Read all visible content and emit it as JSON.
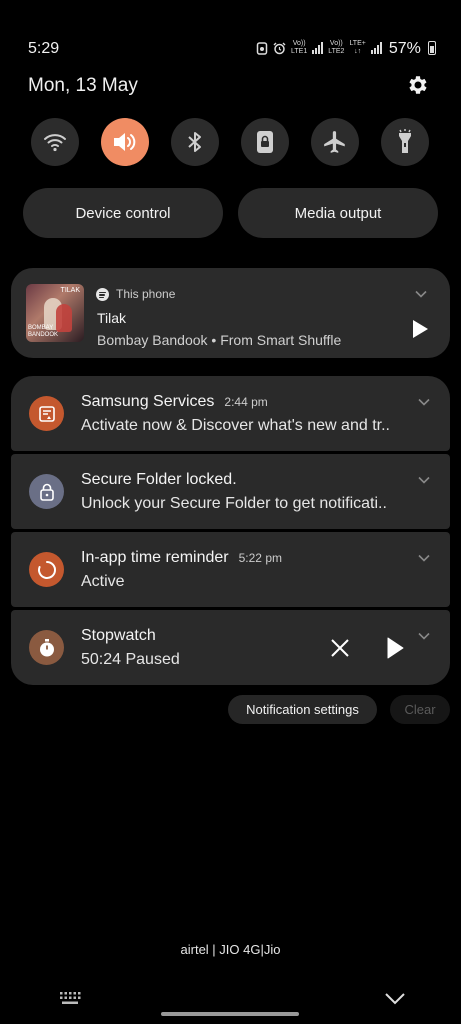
{
  "status_bar": {
    "time": "5:29",
    "sim1": {
      "top": "Vo))",
      "bottom": "LTE1"
    },
    "sim2": {
      "top": "Vo))",
      "bottom": "LTE2"
    },
    "sim2_net": {
      "top": "LTE+",
      "bottom": "↓↑"
    },
    "battery_percent": "57%",
    "battery_level": 0.57
  },
  "header": {
    "date": "Mon, 13 May"
  },
  "quick_toggles": [
    {
      "name": "wifi",
      "active": false
    },
    {
      "name": "sound",
      "active": true
    },
    {
      "name": "bluetooth",
      "active": false
    },
    {
      "name": "screen-lock-rotation",
      "active": false
    },
    {
      "name": "airplane",
      "active": false
    },
    {
      "name": "flashlight",
      "active": false
    }
  ],
  "buttons": {
    "device_control": "Device control",
    "media_output": "Media output"
  },
  "media": {
    "source": "This phone",
    "title": "Tilak",
    "artist": "Bombay Bandook • From Smart Shuffle",
    "album_title": "TILAK",
    "album_subtitle": "BOMBAY BANDOOK"
  },
  "notifications": [
    {
      "title": "Samsung Services",
      "time": "2:44 pm",
      "text": "Activate now & Discover what's new and tr..",
      "icon": "samsung-services-icon",
      "color": "#c4582e"
    },
    {
      "title": "Secure Folder locked.",
      "time": "",
      "text": "Unlock your Secure Folder to get notificati..",
      "icon": "lock-icon",
      "color": "#6a6f86"
    },
    {
      "title": "In-app time reminder",
      "time": "5:22 pm",
      "text": "Active",
      "icon": "timer-ring-icon",
      "color": "#c4582e"
    },
    {
      "title": "Stopwatch",
      "time": "",
      "text": "50:24  Paused",
      "icon": "stopwatch-icon",
      "color": "#8a5a40"
    }
  ],
  "footer": {
    "notification_settings": "Notification settings",
    "clear": "Clear",
    "carrier": "airtel | JIO 4G|Jio"
  },
  "colors": {
    "accent": "#f08c63",
    "card": "#2a2a2a",
    "background": "#000000"
  }
}
